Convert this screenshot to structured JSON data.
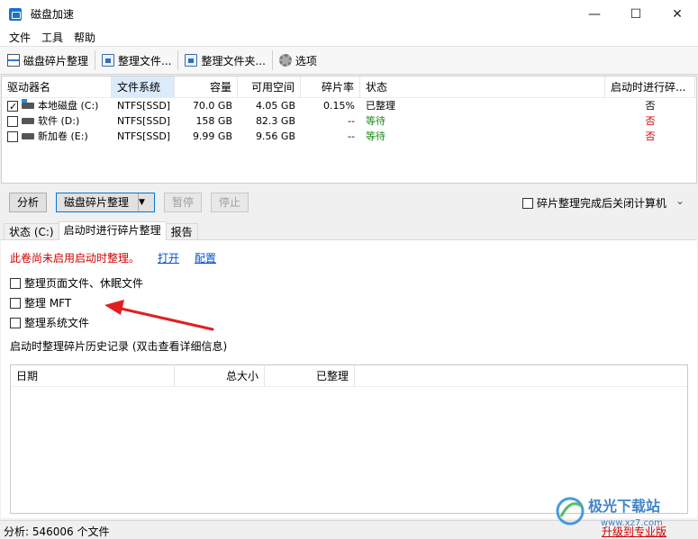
{
  "window": {
    "title": "磁盘加速"
  },
  "menu": {
    "items": [
      "文件",
      "工具",
      "帮助"
    ]
  },
  "toolbar": {
    "defrag": "磁盘碎片整理",
    "defrag_file": "整理文件...",
    "defrag_folder": "整理文件夹...",
    "options": "选项"
  },
  "drives": {
    "columns": [
      "驱动器名",
      "文件系统",
      "容量",
      "可用空间",
      "碎片率",
      "状态",
      "启动时进行碎..."
    ],
    "rows": [
      {
        "checked": true,
        "name": "本地磁盘 (C:)",
        "fs": "NTFS[SSD]",
        "capacity": "70.0 GB",
        "free": "4.05 GB",
        "frag": "0.15%",
        "status": "已整理",
        "boot": "否"
      },
      {
        "checked": false,
        "name": "软件 (D:)",
        "fs": "NTFS[SSD]",
        "capacity": "158 GB",
        "free": "82.3 GB",
        "frag": "--",
        "status": "等待",
        "boot": "否"
      },
      {
        "checked": false,
        "name": "新加卷 (E:)",
        "fs": "NTFS[SSD]",
        "capacity": "9.99 GB",
        "free": "9.56 GB",
        "frag": "--",
        "status": "等待",
        "boot": "否"
      }
    ]
  },
  "actions": {
    "analyze": "分析",
    "defrag": "磁盘碎片整理",
    "pause": "暂停",
    "stop": "停止",
    "shutdown_label": "碎片整理完成后关闭计算机"
  },
  "tabs": [
    "状态 (C:)",
    "启动时进行碎片整理",
    "报告"
  ],
  "boot_panel": {
    "warning": "此卷尚未启用启动时整理。",
    "open_link": "打开",
    "config_link": "配置",
    "options": [
      "整理页面文件、休眠文件",
      "整理 MFT",
      "整理系统文件"
    ],
    "history_label": "启动时整理碎片历史记录 (双击查看详细信息)",
    "history_columns": [
      "日期",
      "总大小",
      "已整理"
    ]
  },
  "statusbar": {
    "text": "分析: 546006 个文件",
    "upgrade": "升级到专业版"
  },
  "watermark": {
    "text": "极光下载站",
    "url": "www.xz7.com"
  },
  "colors": {
    "warning": "#d00000",
    "link": "#0055cc",
    "waiting": "#1a8a1a",
    "accent": "#0078d7"
  }
}
